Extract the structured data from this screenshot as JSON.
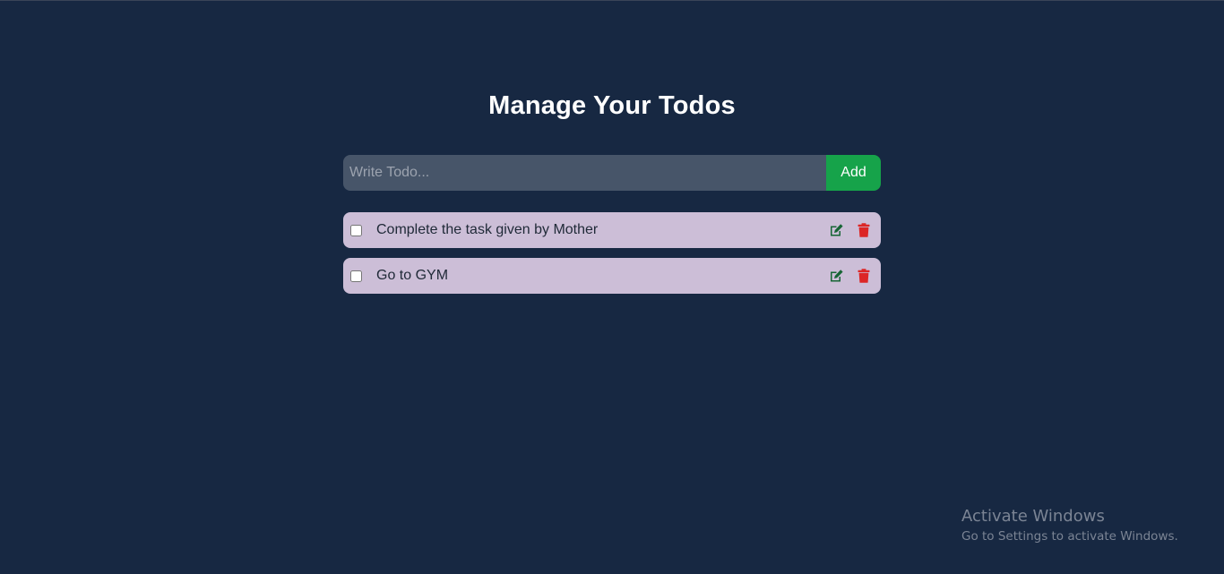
{
  "app": {
    "title": "Manage Your Todos"
  },
  "form": {
    "placeholder": "Write Todo...",
    "value": "",
    "add_label": "Add"
  },
  "todos": [
    {
      "text": "Complete the task given by Mother",
      "completed": false
    },
    {
      "text": "Go to GYM",
      "completed": false
    }
  ],
  "icons": {
    "edit": "edit-icon",
    "delete": "trash-icon"
  },
  "colors": {
    "background": "#172842",
    "input_bg": "#475569",
    "add_button": "#16a34a",
    "todo_bg": "#ccbed7",
    "edit_icon": "#15803d",
    "delete_icon": "#dc2626"
  },
  "watermark": {
    "title": "Activate Windows",
    "subtitle": "Go to Settings to activate Windows."
  }
}
